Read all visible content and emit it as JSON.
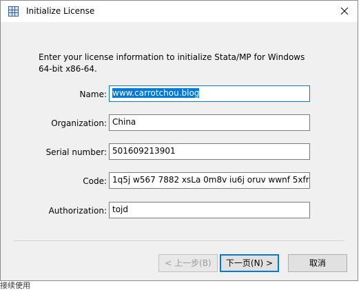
{
  "window": {
    "title": "Initialize License",
    "close_icon": "close-icon"
  },
  "instruction": "Enter your license information to initialize Stata/MP for Windows 64-bit x86-64.",
  "fields": [
    {
      "label": "Name:",
      "value": "www.carrotchou.blog",
      "selected": true
    },
    {
      "label": "Organization:",
      "value": "China"
    },
    {
      "label": "Serial number:",
      "value": "501609213901"
    },
    {
      "label": "Code:",
      "value": "1q5j w567 7882 xsLa 0m8v iu6j oruv wwnf 5xfr"
    },
    {
      "label": "Authorization:",
      "value": "tojd"
    }
  ],
  "buttons": {
    "back": "< 上一步(B)",
    "next": "下一页(N) >",
    "cancel": "取消"
  },
  "background_text": "接续使用"
}
